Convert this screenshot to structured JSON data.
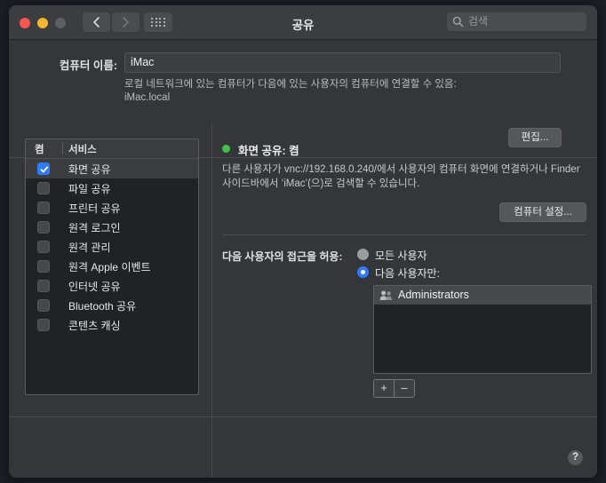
{
  "window": {
    "title": "공유",
    "traffic_lights": {
      "close": "close",
      "minimize": "minimize",
      "maximize": "maximize"
    },
    "nav": {
      "back": "back-chevron",
      "forward": "forward-chevron",
      "grid": "show-all-grid"
    }
  },
  "search": {
    "placeholder": "검색",
    "value": "",
    "icon": "search-icon"
  },
  "computer_name": {
    "label": "컴퓨터 이름:",
    "value": "iMac",
    "hint": "로컬 네트워크에 있는 컴퓨터가 다음에 있는 사용자의 컴퓨터에 연결할 수 있음:",
    "hostname": "iMac.local",
    "edit_label": "편집..."
  },
  "services": {
    "header_on": "켬",
    "header_service": "서비스",
    "items": [
      {
        "label": "화면 공유",
        "checked": true,
        "selected": true
      },
      {
        "label": "파일 공유",
        "checked": false,
        "selected": false
      },
      {
        "label": "프린터 공유",
        "checked": false,
        "selected": false
      },
      {
        "label": "원격 로그인",
        "checked": false,
        "selected": false
      },
      {
        "label": "원격 관리",
        "checked": false,
        "selected": false
      },
      {
        "label": "원격 Apple 이벤트",
        "checked": false,
        "selected": false
      },
      {
        "label": "인터넷 공유",
        "checked": false,
        "selected": false
      },
      {
        "label": "Bluetooth 공유",
        "checked": false,
        "selected": false
      },
      {
        "label": "콘텐츠 캐싱",
        "checked": false,
        "selected": false
      }
    ]
  },
  "detail": {
    "status_text": "화면 공유: 켬",
    "status_color": "#41c34a",
    "description": "다른 사용자가 vnc://192.168.0.240/에서 사용자의 컴퓨터 화면에 연결하거나 Finder 사이드바에서 ‘iMac’(으)로 검색할 수 있습니다.",
    "computer_settings_label": "컴퓨터 설정...",
    "access_label": "다음 사용자의 접근을 허용:",
    "radios": [
      {
        "label": "모든 사용자",
        "selected": false
      },
      {
        "label": "다음 사용자만:",
        "selected": true
      }
    ],
    "users": [
      {
        "name": "Administrators",
        "icon": "group-icon",
        "selected": true
      }
    ],
    "add_label": "+",
    "remove_label": "–"
  },
  "help": {
    "label": "?"
  },
  "accent_color": "#2f7cf6"
}
